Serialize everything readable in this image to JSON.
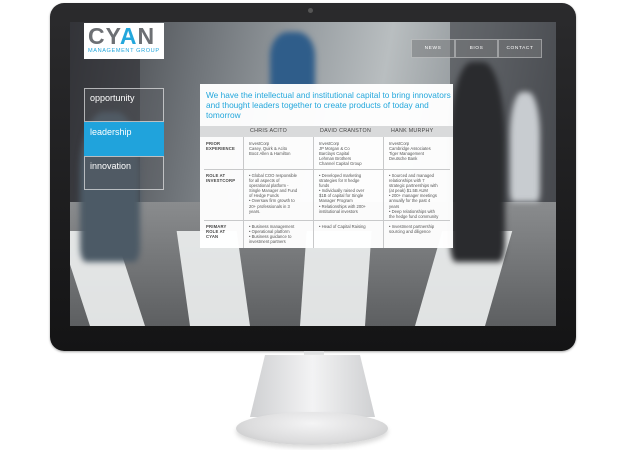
{
  "logo": {
    "name": "CYAN",
    "sub": "MANAGEMENT GROUP"
  },
  "nav": [
    {
      "label": "NEWS"
    },
    {
      "label": "BIOS"
    },
    {
      "label": "CONTACT"
    }
  ],
  "sidebar": [
    {
      "label": "opportunity",
      "active": false
    },
    {
      "label": "leadership",
      "active": true
    },
    {
      "label": "innovation",
      "active": false
    }
  ],
  "headline": "We have the intellectual and institutional capital to bring innovators and thought leaders together to create products of today and tomorrow",
  "table": {
    "columns": [
      "CHRIS ACITO",
      "DAVID CRANSTON",
      "HANK MURPHY"
    ],
    "rows": [
      {
        "label": "PRIOR\nEXPERIENCE",
        "cells": [
          "InvestCorp\nCasey, Quirk & Acito\nBooz Allen & Hamilton",
          "InvestCorp\nJP Morgan & Co\nBarclays Capital\nLehman Brothers\nChannel Capital Group",
          "InvestCorp\nCambridge Associates\nTiger Management\nDeutsche Bank"
        ]
      },
      {
        "label": "ROLE AT\nINVESTCORP",
        "cells": [
          "• Global COO responsible\nfor all aspects of\noperational platform -\nSingle Manager and Fund\nof Hedge Funds\n• Oversaw firm growth to\n20+ professionals in 3\nyears.",
          "• Developed marketing\nstrategies for 8 hedge\nfunds\n• Individually raised over\n$1B of capital for Single\nManager Program\n• Relationships with 200+\ninstitutional investors",
          "• Sourced and managed\nrelationships with 7\nstrategic partnerships with\n(at peak) $1.5B AUM\n• 200+ manager meetings\nannually for the past 4\nyears\n• Deep relationships with\nthe hedge fund community"
        ]
      },
      {
        "label": "PRIMARY\nROLE AT\nCYAN",
        "cells": [
          "• Business management\n• Operational platform\n• Business guidance to\ninvestment partners",
          "• Head of Capital Raising",
          "• Investment partnership\nsourcing and diligence"
        ]
      }
    ]
  },
  "colors": {
    "accent": "#20a3dc",
    "bezel": "#1e1e20",
    "panel": "#ffffff"
  }
}
